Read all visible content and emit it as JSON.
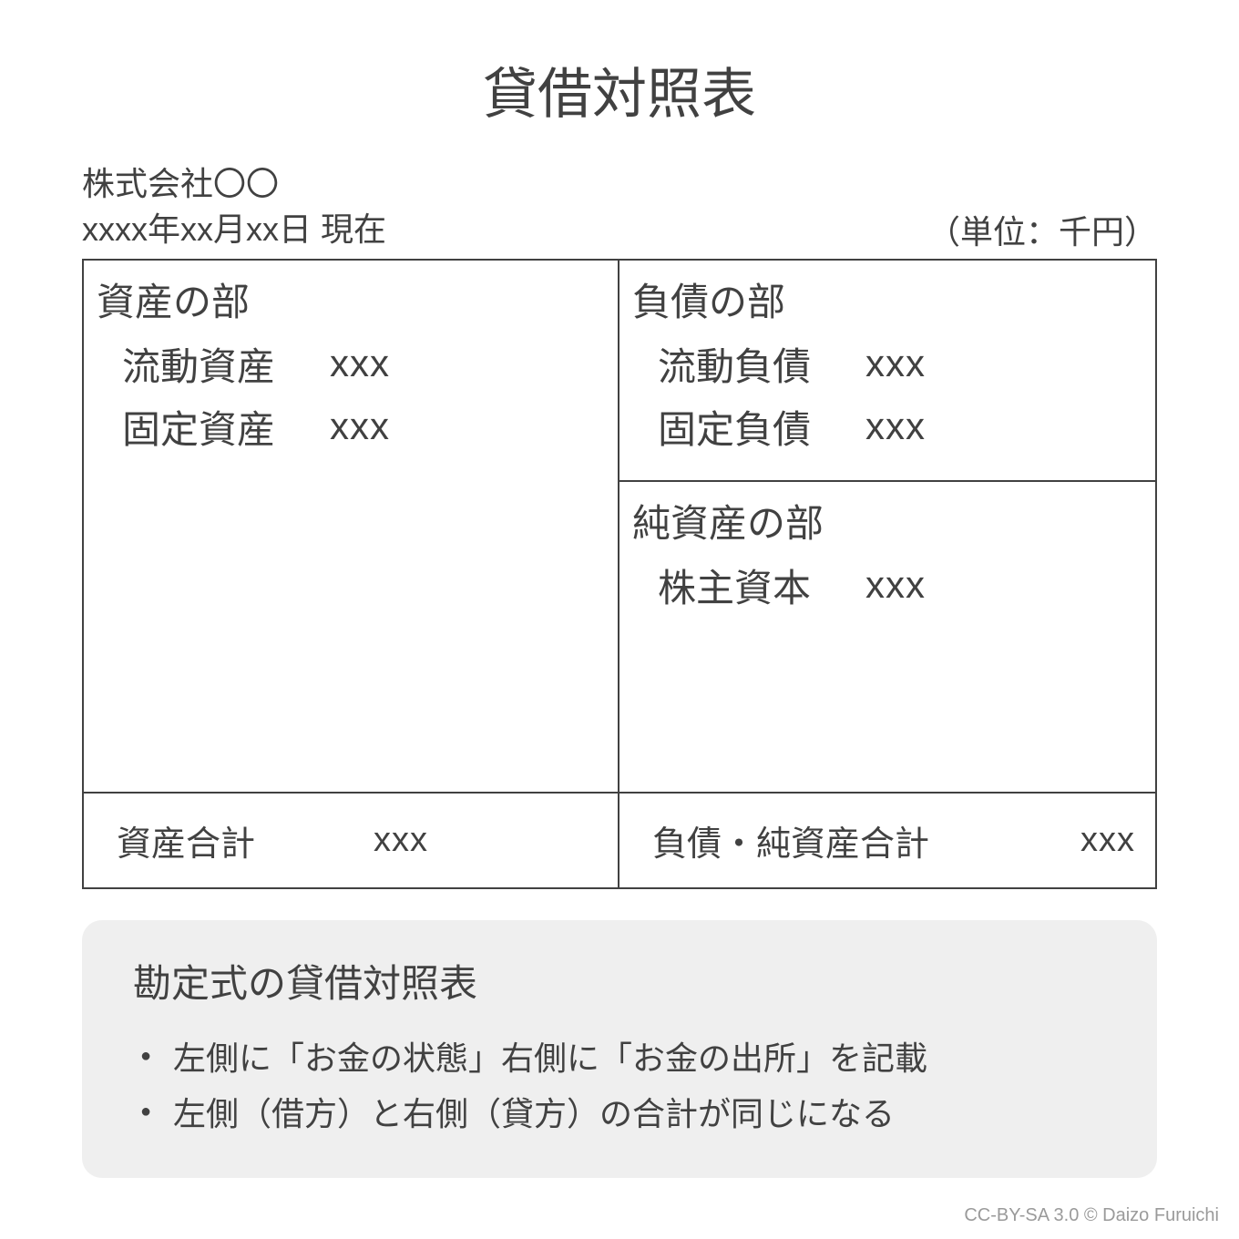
{
  "title": "貸借対照表",
  "company": "株式会社〇〇",
  "date_line": "xxxx年xx月xx日 現在",
  "unit": "（単位：千円）",
  "left": {
    "heading": "資産の部",
    "items": [
      {
        "label": "流動資産",
        "value": "xxx"
      },
      {
        "label": "固定資産",
        "value": "xxx"
      }
    ]
  },
  "right_top": {
    "heading": "負債の部",
    "items": [
      {
        "label": "流動負債",
        "value": "xxx"
      },
      {
        "label": "固定負債",
        "value": "xxx"
      }
    ]
  },
  "right_bottom": {
    "heading": "純資産の部",
    "items": [
      {
        "label": "株主資本",
        "value": "xxx"
      }
    ]
  },
  "totals": {
    "left": {
      "label": "資産合計",
      "value": "xxx"
    },
    "right": {
      "label": "負債・純資産合計",
      "value": "xxx"
    }
  },
  "note": {
    "title": "勘定式の貸借対照表",
    "bullets": [
      "左側に「お金の状態」右側に「お金の出所」を記載",
      "左側（借方）と右側（貸方）の合計が同じになる"
    ]
  },
  "attribution": "CC-BY-SA 3.0 © Daizo Furuichi"
}
